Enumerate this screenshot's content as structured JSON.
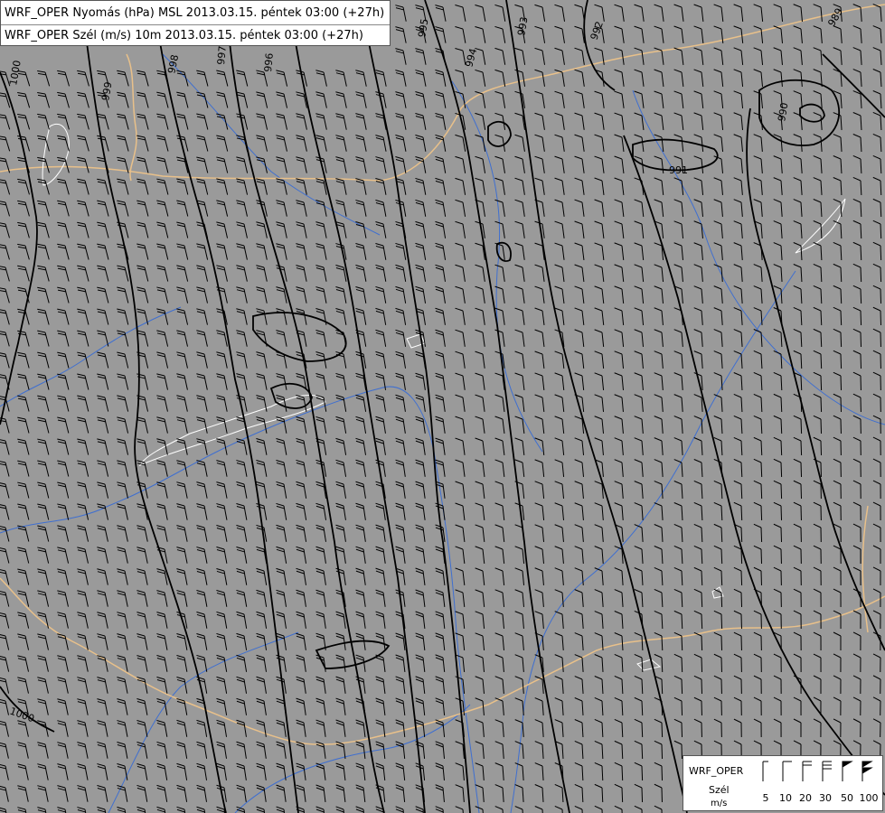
{
  "title": {
    "line1": "WRF_OPER Nyomás (hPa) MSL 2013.03.15. péntek 03:00 (+27h)",
    "line2": "WRF_OPER Szél (m/s) 10m 2013.03.15. péntek 03:00 (+27h)"
  },
  "legend": {
    "model": "WRF_OPER",
    "label": "Szél",
    "unit": "m/s",
    "speeds": [
      "5",
      "10",
      "20",
      "30",
      "50",
      "100"
    ]
  },
  "isobar_labels": [
    "1000",
    "999",
    "998",
    "997",
    "996",
    "995",
    "994",
    "993",
    "992",
    "991",
    "990",
    "989",
    "1000"
  ],
  "colors": {
    "background": "#9a9a9a",
    "isobar": "#000000",
    "border": "#e8c08a",
    "river": "#3f6fd0",
    "lake": "#ffffff",
    "barb": "#000000"
  },
  "icons": {
    "barb_5": "wind-barb-5-icon",
    "barb_10": "wind-barb-10-icon",
    "barb_20": "wind-barb-20-icon",
    "barb_30": "wind-barb-30-icon",
    "barb_50": "wind-barb-50-icon",
    "barb_100": "wind-barb-100-icon"
  }
}
